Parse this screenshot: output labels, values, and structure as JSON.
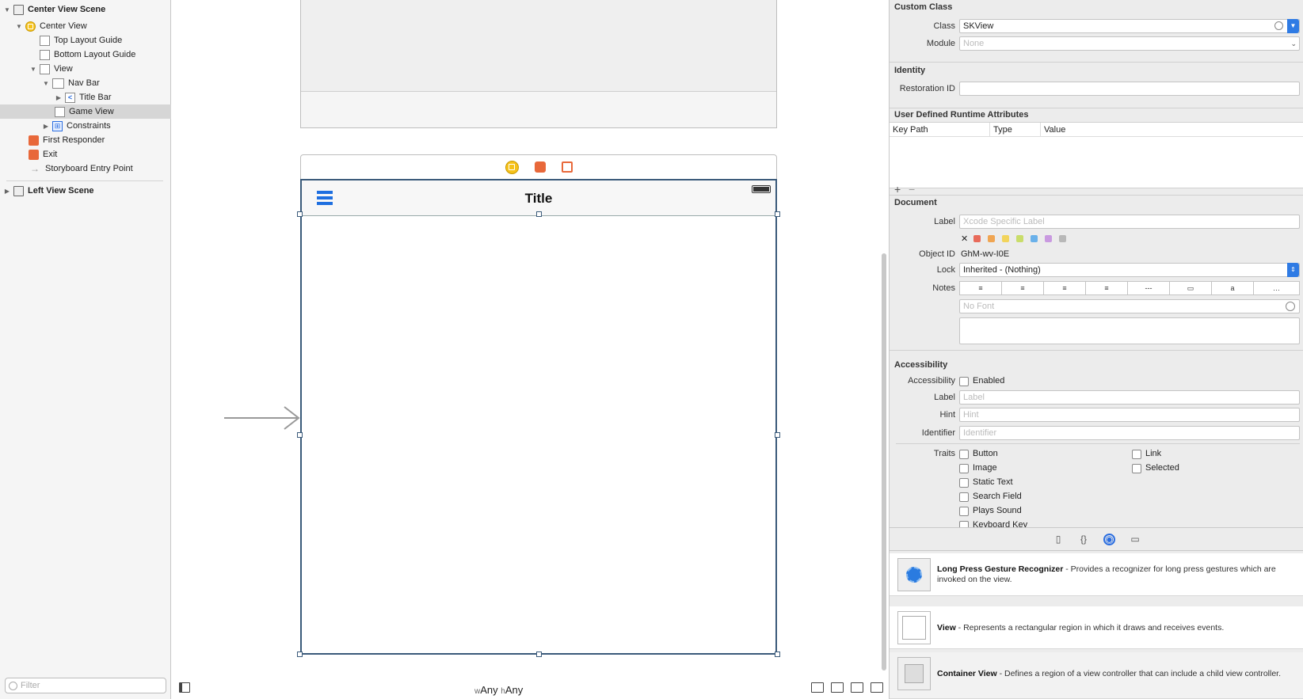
{
  "outline": {
    "items": [
      {
        "label": "Center View Scene",
        "bold": true
      },
      {
        "label": "Center View"
      },
      {
        "label": "Top Layout Guide"
      },
      {
        "label": "Bottom Layout Guide"
      },
      {
        "label": "View"
      },
      {
        "label": "Nav Bar"
      },
      {
        "label": "Title Bar"
      },
      {
        "label": "Game View",
        "selected": true
      },
      {
        "label": "Constraints"
      },
      {
        "label": "First Responder"
      },
      {
        "label": "Exit"
      },
      {
        "label": "Storyboard Entry Point"
      },
      {
        "label": "Left View Scene",
        "bold": true
      }
    ],
    "filter_placeholder": "Filter"
  },
  "canvas": {
    "nav_title": "Title",
    "size_class_w": "w",
    "size_class_w_value": "Any",
    "size_class_h": "h",
    "size_class_h_value": "Any"
  },
  "inspector": {
    "custom_class": {
      "header": "Custom Class",
      "class_label": "Class",
      "class_value": "SKView",
      "module_label": "Module",
      "module_placeholder": "None"
    },
    "identity": {
      "header": "Identity",
      "restoration_label": "Restoration ID",
      "restoration_value": ""
    },
    "runtime_attrs": {
      "header": "User Defined Runtime Attributes",
      "col_keypath": "Key Path",
      "col_type": "Type",
      "col_value": "Value",
      "add": "+",
      "remove": "−"
    },
    "document": {
      "header": "Document",
      "label_label": "Label",
      "label_placeholder": "Xcode Specific Label",
      "clear_color": "✕",
      "swatches": [
        "#e86a5a",
        "#f0a552",
        "#f2d45c",
        "#c9dd6a",
        "#6ab1ea",
        "#c99ae0",
        "#b8b8b8"
      ],
      "objectid_label": "Object ID",
      "objectid_value": "GhM-wv-I0E",
      "lock_label": "Lock",
      "lock_value": "Inherited - (Nothing)",
      "notes_label": "Notes",
      "font_placeholder": "No Font"
    },
    "accessibility": {
      "header": "Accessibility",
      "acc_label": "Accessibility",
      "enabled_label": "Enabled",
      "label_label": "Label",
      "label_placeholder": "Label",
      "hint_label": "Hint",
      "hint_placeholder": "Hint",
      "identifier_label": "Identifier",
      "identifier_placeholder": "Identifier",
      "traits_label": "Traits",
      "traits_left": [
        "Button",
        "Image",
        "Static Text",
        "Search Field",
        "Plays Sound",
        "Keyboard Key"
      ],
      "traits_right": [
        "Link",
        "Selected"
      ]
    },
    "library": {
      "items": [
        {
          "title": "Long Press Gesture Recognizer",
          "desc": " - Provides a recognizer for long press gestures which are invoked on the view."
        },
        {
          "title": "View",
          "desc": " - Represents a rectangular region in which it draws and receives events."
        },
        {
          "title": "Container View",
          "desc": " - Defines a region of a view controller that can include a child view controller."
        }
      ]
    }
  }
}
